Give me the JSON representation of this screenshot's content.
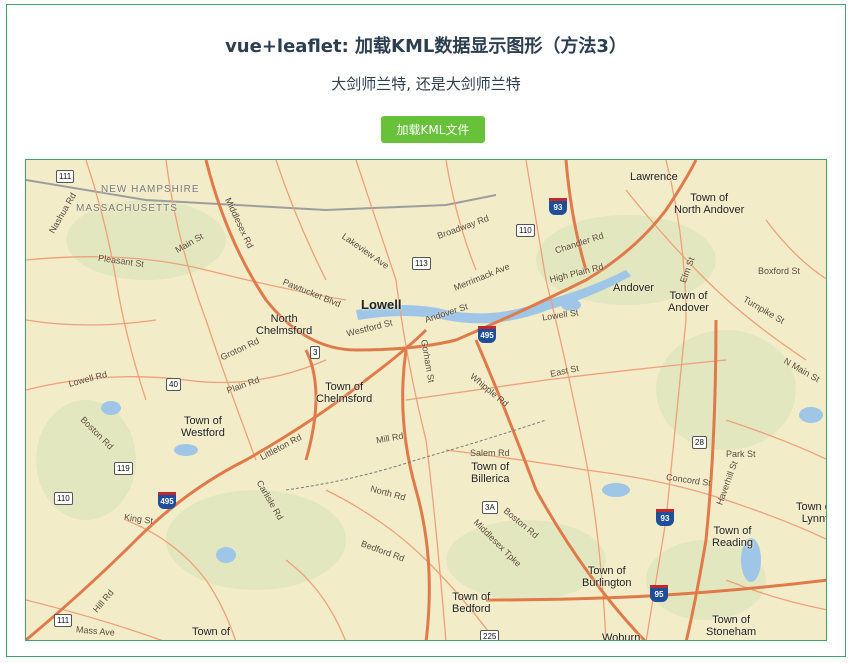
{
  "header": {
    "title": "vue+leaflet: 加载KML数据显示图形（方法3）",
    "subtitle": "大剑师兰特, 还是大剑师兰特",
    "load_button_label": "加载KML文件"
  },
  "map": {
    "states": [
      "NEW HAMPSHIRE",
      "MASSACHUSETTS"
    ],
    "cities": [
      {
        "name": "Lowell",
        "major": true
      },
      {
        "name": "North\nChelmsford"
      },
      {
        "name": "Town of\nChelmsford"
      },
      {
        "name": "Town of\nWestford"
      },
      {
        "name": "Lawrence"
      },
      {
        "name": "Town of\nNorth Andover"
      },
      {
        "name": "Andover"
      },
      {
        "name": "Town of\nAndover"
      },
      {
        "name": "Town of\nBillerica"
      },
      {
        "name": "Town of\nBurlington"
      },
      {
        "name": "Town of\nBedford"
      },
      {
        "name": "Town of\nReading"
      },
      {
        "name": "Town of\nStoneham"
      },
      {
        "name": "Town of\nLynnf"
      },
      {
        "name": "Woburn"
      },
      {
        "name": "Town of"
      }
    ],
    "roads": [
      "Westford St",
      "Andover St",
      "Merrimack Ave",
      "Pawtucket Blvd",
      "Gorham St",
      "Chandler Rd",
      "High Plain Rd",
      "Lowell St",
      "East St",
      "Whipple Rd",
      "Salem Rd",
      "Concord St",
      "Boston Rd",
      "Middlesex Tpke",
      "Bedford Rd",
      "Littleton Rd",
      "Carlisle Rd",
      "Groton Rd",
      "Lowell Rd",
      "Boston Rd",
      "Broadway Rd",
      "Pleasant St",
      "Main St",
      "Mill Rd",
      "Nashua Rd",
      "Park St",
      "Elm St",
      "Boxford St",
      "Turnpike St",
      "N Main St",
      "Haverhill St",
      "Middlesex Rd",
      "Lakeview Ave",
      "Plain Rd",
      "North Rd",
      "Mass Ave",
      "King St",
      "Hill Rd"
    ],
    "shields": [
      "111",
      "110",
      "113",
      "3",
      "40",
      "119",
      "28",
      "225",
      "3A"
    ],
    "interstates": [
      "93",
      "495",
      "95"
    ]
  }
}
